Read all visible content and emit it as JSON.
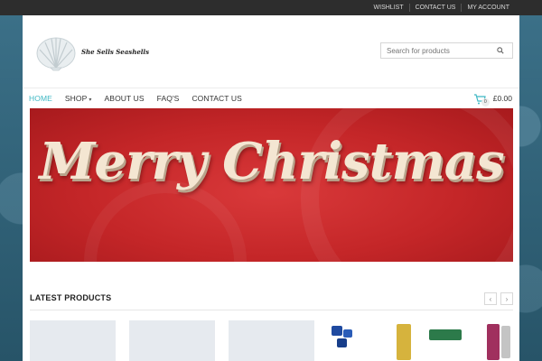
{
  "topbar": {
    "links": [
      "WISHLIST",
      "CONTACT US",
      "MY ACCOUNT"
    ]
  },
  "logo": {
    "text": "She Sells Seashells"
  },
  "search": {
    "placeholder": "Search for products",
    "icon": "search-icon"
  },
  "nav": {
    "items": [
      "HOME",
      "SHOP",
      "ABOUT US",
      "FAQ'S",
      "CONTACT US"
    ],
    "active": "HOME"
  },
  "cart": {
    "count": "0",
    "total": "£0.00",
    "icon": "cart-icon"
  },
  "banner": {
    "text": "Merry Christmas"
  },
  "products_section": {
    "title": "LATEST PRODUCTS"
  },
  "colors": {
    "accent": "#3fb8c4",
    "topbar": "#2d2d2d",
    "banner_red": "#c42628"
  }
}
